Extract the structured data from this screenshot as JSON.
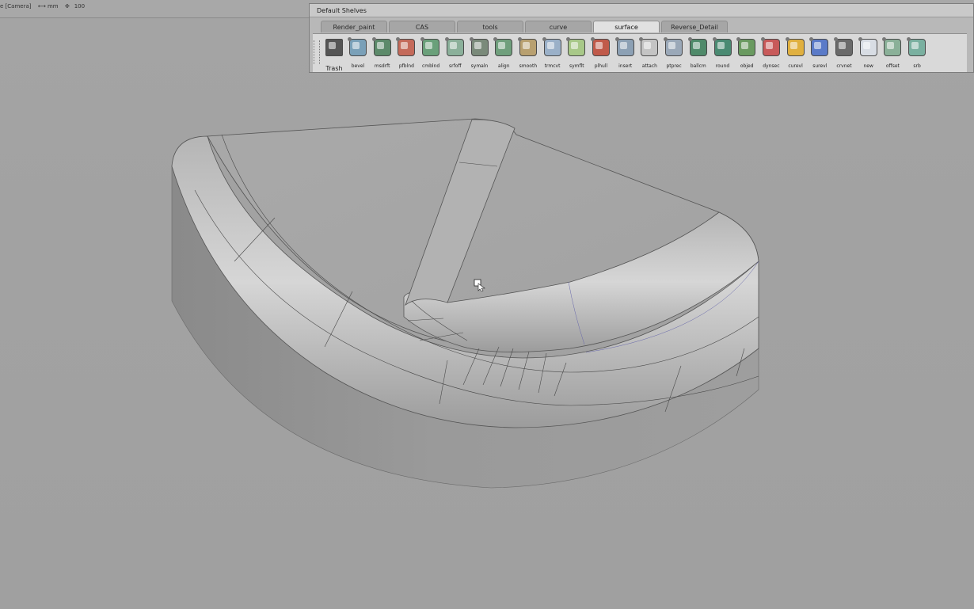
{
  "topbar": {
    "camera_label": "e [Camera]",
    "units_label": "⟷ mm",
    "grid_label": "100"
  },
  "shelf": {
    "title": "Default Shelves",
    "tabs": [
      {
        "label": "Render_paint",
        "active": false
      },
      {
        "label": "CAS",
        "active": false
      },
      {
        "label": "tools",
        "active": false
      },
      {
        "label": "curve",
        "active": false
      },
      {
        "label": "surface",
        "active": true
      },
      {
        "label": "Reverse_Detail",
        "active": false
      }
    ],
    "trash_label": "Trash",
    "tools": [
      {
        "label": "bevel",
        "icon": "bevel-icon",
        "color": "#7aa0b8"
      },
      {
        "label": "msdrft",
        "icon": "draft-icon",
        "color": "#5c8a6a"
      },
      {
        "label": "pfblnd",
        "icon": "profile-blend-icon",
        "color": "#c46a5a"
      },
      {
        "label": "cmblnd",
        "icon": "blend-icon",
        "color": "#6aa07a"
      },
      {
        "label": "srfoff",
        "icon": "surface-offset-icon",
        "color": "#8bb09a"
      },
      {
        "label": "symaln",
        "icon": "symmetric-align-icon",
        "color": "#7a8a7a"
      },
      {
        "label": "align",
        "icon": "align-icon",
        "color": "#6f9f7c"
      },
      {
        "label": "smooth",
        "icon": "smooth-icon",
        "color": "#b8a070"
      },
      {
        "label": "trmcvt",
        "icon": "trim-convert-icon",
        "color": "#9ab0c8"
      },
      {
        "label": "symflt",
        "icon": "symmetric-fillet-icon",
        "color": "#a8c888"
      },
      {
        "label": "plhull",
        "icon": "plane-hull-icon",
        "color": "#c05a4a"
      },
      {
        "label": "insert",
        "icon": "insert-icon",
        "color": "#8ca0b4"
      },
      {
        "label": "attach",
        "icon": "attach-icon",
        "color": "#c4c4c4"
      },
      {
        "label": "ptprec",
        "icon": "point-precision-icon",
        "color": "#9aa8b8"
      },
      {
        "label": "ballcm",
        "icon": "ball-corner-icon",
        "color": "#4f8a6a"
      },
      {
        "label": "round",
        "icon": "round-icon",
        "color": "#4a8a72"
      },
      {
        "label": "objed",
        "icon": "object-edit-icon",
        "color": "#6a9a60"
      },
      {
        "label": "dynsec",
        "icon": "dynamic-section-icon",
        "color": "#c85a5a"
      },
      {
        "label": "curevl",
        "icon": "curve-eval-icon",
        "color": "#e0b040"
      },
      {
        "label": "surevl",
        "icon": "surface-eval-icon",
        "color": "#5a7ac8"
      },
      {
        "label": "crvnet",
        "icon": "curve-network-icon",
        "color": "#6a6a6a"
      },
      {
        "label": "new",
        "icon": "new-icon",
        "color": "#d8dde4"
      },
      {
        "label": "offset",
        "icon": "offset-icon",
        "color": "#8ab098"
      },
      {
        "label": "srb",
        "icon": "surface-rebuild-icon",
        "color": "#7ab0a0"
      }
    ]
  }
}
